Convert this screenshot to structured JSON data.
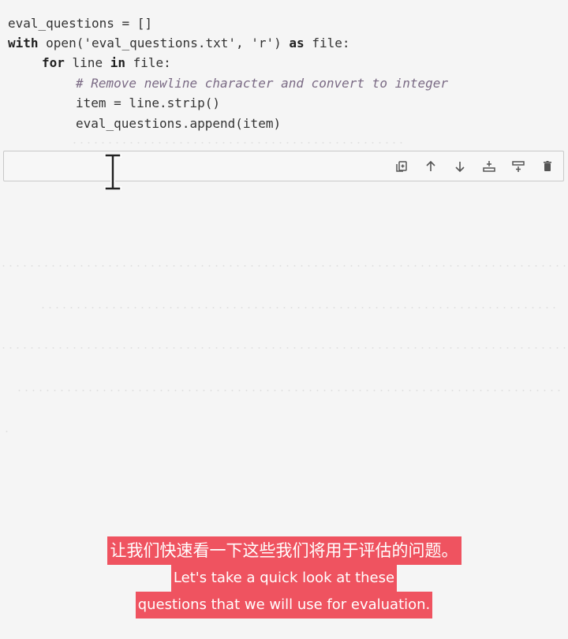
{
  "code": {
    "line1": "eval_questions = []",
    "line2_kw_with": "with",
    "line2_rest": " open('eval_questions.txt', 'r') ",
    "line2_kw_as": "as",
    "line2_end": " file:",
    "line3_kw_for": "for",
    "line3_mid": " line ",
    "line3_kw_in": "in",
    "line3_end": " file:",
    "line4_comment": "# Remove newline character and convert to integer",
    "line5": "item = line.strip()",
    "line6": "eval_questions.append(item)"
  },
  "toolbar": {
    "icons": [
      "copy-icon",
      "arrow-up-icon",
      "arrow-down-icon",
      "insert-above-icon",
      "insert-below-icon",
      "trash-icon"
    ]
  },
  "subtitles": {
    "zh": "让我们快速看一下这些我们将用于评估的问题。",
    "en_line1": "Let's take a quick look at these",
    "en_line2": "questions that we will use for evaluation."
  },
  "colors": {
    "subtitle_bg": "#ef5360",
    "comment": "#7a6a84",
    "background": "#f5f5f5"
  }
}
